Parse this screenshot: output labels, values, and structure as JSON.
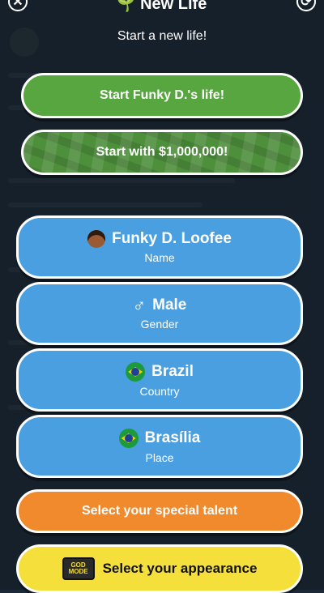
{
  "header": {
    "title": "New Life",
    "subtitle": "Start a new life!",
    "close_symbol": "✕",
    "refresh_symbol": "⟳",
    "title_icon": "sprout-icon"
  },
  "buttons": {
    "start_life": "Start Funky D.'s life!",
    "start_money": "Start with $1,000,000!",
    "name_value": "Funky D. Loofee",
    "name_label": "Name",
    "gender_value": "Male",
    "gender_label": "Gender",
    "country_value": "Brazil",
    "country_label": "Country",
    "place_value": "Brasília",
    "place_label": "Place",
    "special_talent": "Select your special talent",
    "appearance": "Select your appearance",
    "god_mode_badge": "GOD MODE"
  },
  "colors": {
    "green": "#57a640",
    "blue": "#4a9fe0",
    "orange": "#f08a2c",
    "yellow": "#f5df3a"
  }
}
